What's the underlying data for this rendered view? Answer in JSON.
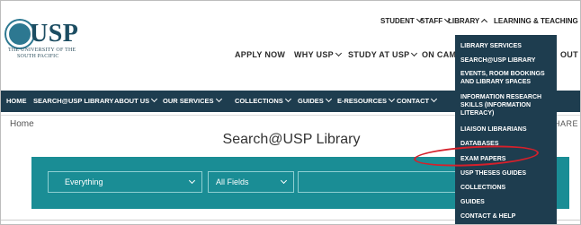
{
  "logo": {
    "text": "USP",
    "line1": "THE UNIVERSITY OF THE",
    "line2": "SOUTH PACIFIC"
  },
  "utility_nav": [
    "STUDENT",
    "STAFF",
    "LIBRARY",
    "LEARNING & TEACHING"
  ],
  "main_nav": [
    "APPLY NOW",
    "WHY USP",
    "STUDY AT USP",
    "ON CAM",
    "OUT U"
  ],
  "library_nav": [
    "HOME",
    "SEARCH@USP LIBRARY",
    "ABOUT US",
    "OUR SERVICES",
    "COLLECTIONS",
    "GUIDES",
    "E-RESOURCES",
    "CONTACT"
  ],
  "breadcrumb": "Home",
  "share": "HARE",
  "page_title": "Search@USP Library",
  "search": {
    "scope": "Everything",
    "field": "All Fields",
    "query": ""
  },
  "dropdown_items": [
    "LIBRARY SERVICES",
    "SEARCH@USP LIBRARY",
    "EVENTS, ROOM BOOKINGS AND LIBRARY SPACES",
    "INFORMATION RESEARCH SKILLS (INFORMATION LITERACY)",
    "LIAISON LIBRARIANS",
    "DATABASES",
    "EXAM PAPERS",
    "USP THESES GUIDES",
    "COLLECTIONS",
    "GUIDES",
    "CONTACT & HELP"
  ],
  "colors": {
    "dark_nav": "#1e3d4f",
    "search_panel": "#1a8d95",
    "highlight": "#d5202b",
    "logo": "#1c4d62"
  }
}
